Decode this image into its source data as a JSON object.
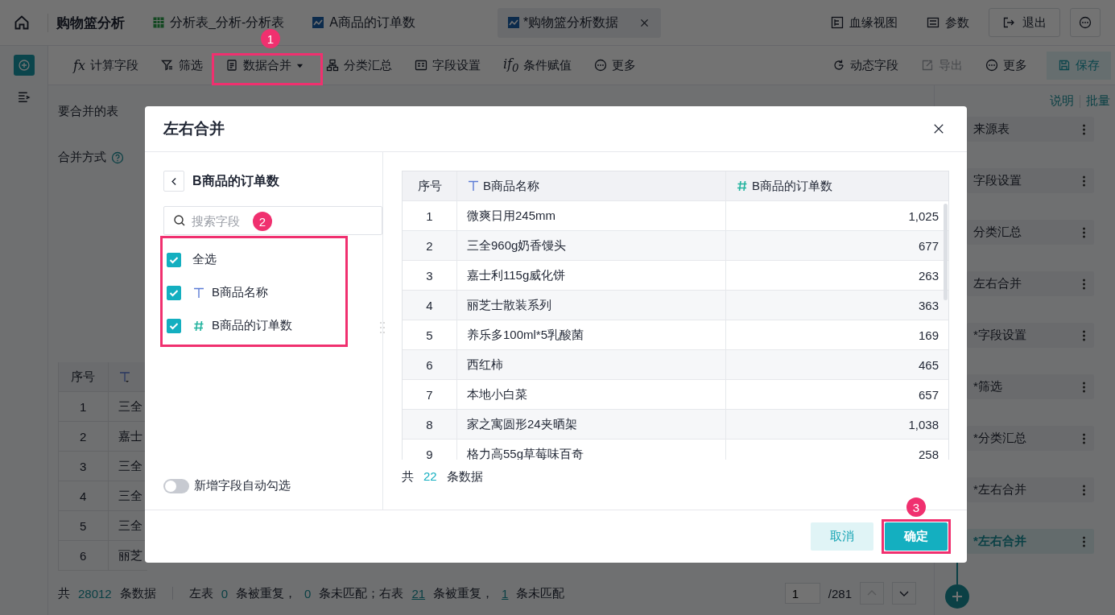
{
  "app": {
    "title": "购物篮分析"
  },
  "tabs": [
    {
      "label": "分析表_分析-分析表",
      "selected": false,
      "kind": "table"
    },
    {
      "label": "A商品的订单数",
      "selected": false,
      "kind": "chart"
    },
    {
      "label": "*购物篮分析数据",
      "selected": true,
      "kind": "chart"
    }
  ],
  "header_actions": [
    {
      "label": "血缘视图",
      "kind": "link"
    },
    {
      "label": "参数",
      "kind": "link"
    },
    {
      "label": "退出",
      "kind": "button"
    }
  ],
  "toolbar": {
    "left": [
      {
        "label": "计算字段",
        "icon_text": "fx",
        "dropdown": false
      },
      {
        "label": "筛选",
        "dropdown": false
      },
      {
        "label": "数据合并",
        "dropdown": true
      },
      {
        "label": "分类汇总",
        "dropdown": false
      },
      {
        "label": "字段设置",
        "dropdown": false
      },
      {
        "label": "条件赋值",
        "icon_text": "if$_{0}$",
        "dropdown": false
      },
      {
        "label": "更多",
        "dropdown": false
      }
    ],
    "right": [
      {
        "label": "动态字段",
        "disabled": false,
        "kind": "plain"
      },
      {
        "label": "导出",
        "disabled": true,
        "kind": "plain"
      },
      {
        "label": "更多",
        "disabled": false,
        "kind": "plain"
      },
      {
        "label": "保存",
        "disabled": false,
        "kind": "primary"
      }
    ]
  },
  "merge_form": {
    "table_label": "要合并的表",
    "method_label": "合并方式"
  },
  "background_table": {
    "columns": [
      {
        "label": "序号",
        "kind": "plain"
      },
      {
        "kind": "text"
      }
    ],
    "rows": [
      {
        "index": "1",
        "cell": "三全"
      },
      {
        "index": "2",
        "cell": "嘉士"
      },
      {
        "index": "3",
        "cell": "三全"
      },
      {
        "index": "4",
        "cell": "三全"
      },
      {
        "index": "5",
        "cell": "三全"
      },
      {
        "index": "6",
        "cell": "丽芝"
      }
    ]
  },
  "status_bar": {
    "groups": [
      [
        {
          "text": "共",
          "kind": "plain"
        },
        {
          "text": "28012",
          "kind": "count"
        },
        {
          "text": "条数据",
          "kind": "plain"
        }
      ],
      [
        {
          "text": "左表",
          "kind": "plain"
        },
        {
          "text": "0",
          "kind": "count"
        },
        {
          "text": "条被重复，",
          "kind": "plain"
        },
        {
          "text": "0",
          "kind": "count"
        },
        {
          "text": "条未匹配；右表",
          "kind": "plain"
        },
        {
          "text": "21",
          "kind": "link"
        },
        {
          "text": "条被重复，",
          "kind": "plain"
        },
        {
          "text": "1",
          "kind": "link"
        },
        {
          "text": "条未匹配",
          "kind": "plain"
        }
      ]
    ],
    "pager": {
      "page": "1",
      "total": "/281"
    }
  },
  "steps": {
    "links": [
      "说明",
      "批量"
    ],
    "items": [
      {
        "label": "来源表",
        "selected": false
      },
      {
        "label": "字段设置",
        "selected": false
      },
      {
        "label": "分类汇总",
        "selected": false
      },
      {
        "label": "左右合并",
        "selected": false
      },
      {
        "label": "*字段设置",
        "selected": false
      },
      {
        "label": "*筛选",
        "selected": false
      },
      {
        "label": "*分类汇总",
        "selected": false
      },
      {
        "label": "*左右合并",
        "selected": false
      },
      {
        "label": "*左右合并",
        "selected": true
      }
    ]
  },
  "dialog": {
    "title": "左右合并",
    "source": "B商品的订单数",
    "search": {
      "placeholder": "搜索字段"
    },
    "fields": [
      {
        "label": "全选",
        "kind": "all",
        "checked": true
      },
      {
        "label": "B商品名称",
        "kind": "text",
        "checked": true
      },
      {
        "label": "B商品的订单数",
        "kind": "number",
        "checked": true
      }
    ],
    "auto_select": {
      "label": "新增字段自动勾选",
      "on": false
    },
    "table": {
      "columns": [
        {
          "label": "序号",
          "kind": "plain"
        },
        {
          "label": "B商品名称",
          "kind": "text"
        },
        {
          "label": "B商品的订单数",
          "kind": "number"
        }
      ],
      "rows": [
        [
          "1",
          "微爽日用245mm",
          "1,025"
        ],
        [
          "2",
          "三全960g奶香馒头",
          "677"
        ],
        [
          "3",
          "嘉士利115g威化饼",
          "263"
        ],
        [
          "4",
          "丽芝士散装系列",
          "363"
        ],
        [
          "5",
          "养乐多100ml*5乳酸菌",
          "169"
        ],
        [
          "6",
          "西红柿",
          "465"
        ],
        [
          "7",
          "本地小白菜",
          "657"
        ],
        [
          "8",
          "家之寓圆形24夹晒架",
          "1,038"
        ],
        [
          "9",
          "格力高55g草莓味百奇",
          "258"
        ]
      ]
    },
    "total": {
      "prefix": "共",
      "count": "22",
      "suffix": "条数据"
    },
    "buttons": [
      {
        "label": "取消",
        "kind": "secondary"
      },
      {
        "label": "确定",
        "kind": "primary"
      }
    ]
  },
  "annotations": [
    {
      "label": "1"
    },
    {
      "label": "2"
    },
    {
      "label": "3"
    }
  ]
}
